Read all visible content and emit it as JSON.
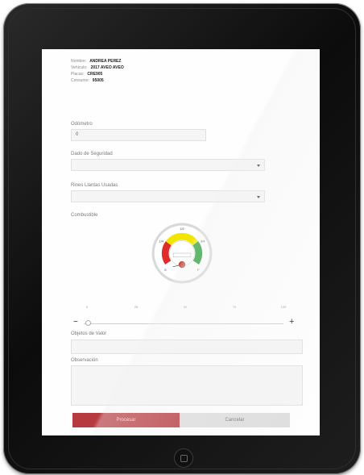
{
  "customer": {
    "name_label": "Nombre:",
    "name_value": "ANDREA PEREZ",
    "vehicle_label": "Vehículo:",
    "vehicle_value": "2017 AVEO AVEO",
    "plate_label": "Placas:",
    "plate_value": "CRE905",
    "consumer_label": "Consumo:",
    "consumer_value": "95005"
  },
  "form": {
    "odometer_label": "Odómetro",
    "odometer_value": "0",
    "security_label": "Dado de Seguridad",
    "security_value": "",
    "wheels_label": "Rines Llantas Usadas",
    "wheels_value": "",
    "fuel_label": "Combustible",
    "objects_label": "Objetos de Valor",
    "objects_value": "",
    "notes_label": "Observación",
    "notes_value": ""
  },
  "gauge": {
    "top_label": "1/2",
    "left_label": "1/4",
    "right_label": "3/4",
    "bottom_left_label": "E",
    "bottom_right_label": "F",
    "level_percent": 0,
    "colors": {
      "red": "#e02b2b",
      "yellow": "#f2e600",
      "green": "#1d9a2e"
    }
  },
  "slider": {
    "ticks": [
      "0",
      "25",
      "50",
      "75",
      "100"
    ],
    "value": 0,
    "minus_label": "−",
    "plus_label": "+"
  },
  "actions": {
    "primary_label": "Procesar",
    "secondary_label": "Cancelar"
  }
}
